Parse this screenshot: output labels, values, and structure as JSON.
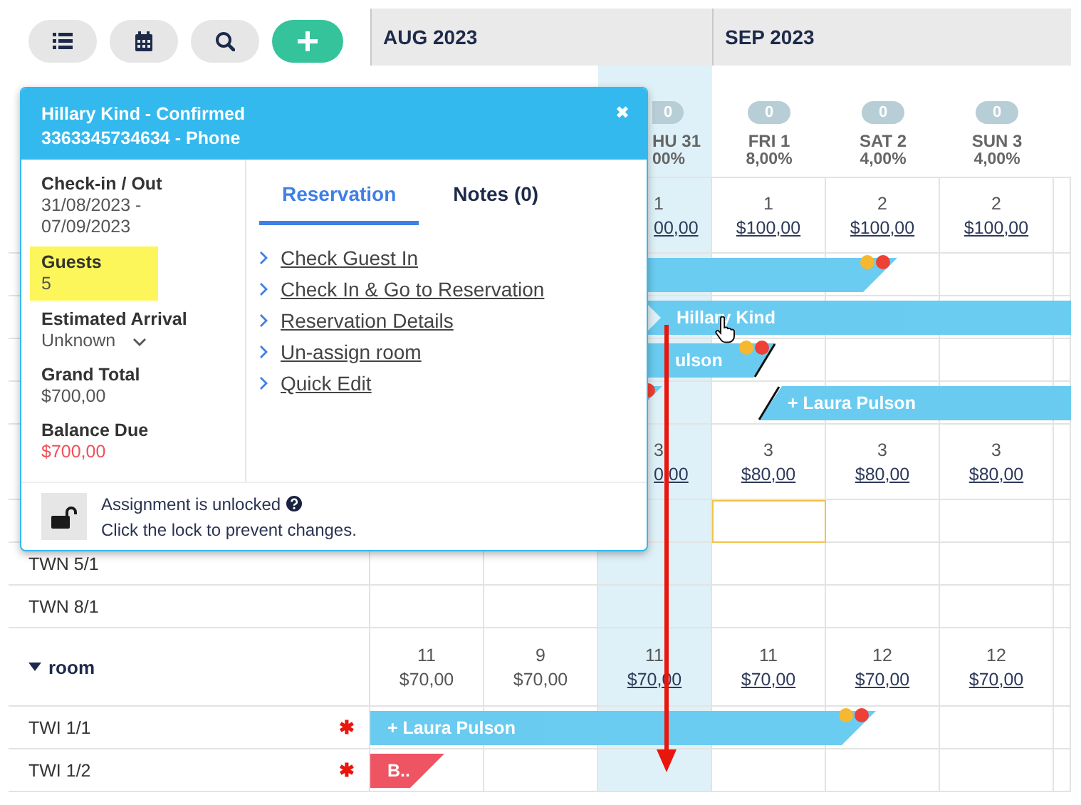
{
  "toolbar": [
    {
      "kind": "list"
    },
    {
      "kind": "calendar"
    },
    {
      "kind": "search"
    },
    {
      "kind": "add"
    }
  ],
  "months": [
    {
      "label": "AUG 2023"
    },
    {
      "label": "SEP 2023"
    }
  ],
  "days": [
    {
      "badge": "0",
      "name": "HU 31",
      "occupancy": "00%",
      "selected": true
    },
    {
      "badge": "0",
      "name": "FRI 1",
      "occupancy": "8,00%",
      "selected": false
    },
    {
      "badge": "0",
      "name": "SAT 2",
      "occupancy": "4,00%",
      "selected": false
    },
    {
      "badge": "0",
      "name": "SUN 3",
      "occupancy": "4,00%",
      "selected": false
    }
  ],
  "rows": [
    {
      "kind": "rates",
      "cells": [
        {
          "count": "1",
          "price": "00,00",
          "underlined": true
        },
        {
          "count": "1",
          "price": "$100,00",
          "underlined": true
        },
        {
          "count": "2",
          "price": "$100,00",
          "underlined": true
        },
        {
          "count": "2",
          "price": "$100,00",
          "underlined": true
        }
      ]
    },
    {
      "kind": "lane"
    },
    {
      "kind": "lane"
    },
    {
      "kind": "lane"
    },
    {
      "kind": "lane"
    },
    {
      "kind": "rates",
      "cells": [
        {
          "count": "3",
          "price": "0,00",
          "underlined": true
        },
        {
          "count": "3",
          "price": "$80,00",
          "underlined": true
        },
        {
          "count": "3",
          "price": "$80,00",
          "underlined": true
        },
        {
          "count": "3",
          "price": "$80,00",
          "underlined": true
        }
      ]
    },
    {
      "kind": "lane",
      "cells": [
        {
          "outlined": false
        },
        {
          "outlined": true
        },
        {
          "outlined": false
        },
        {
          "outlined": false
        }
      ]
    },
    {
      "kind": "unit",
      "label": "TWN 5/1"
    },
    {
      "kind": "unit",
      "label": "TWN 8/1"
    },
    {
      "kind": "group",
      "label": "room",
      "expanded": true,
      "cells": [
        {
          "count": "11",
          "price": "$70,00",
          "underlined": false
        },
        {
          "count": "9",
          "price": "$70,00",
          "underlined": false
        },
        {
          "count": "11",
          "price": "$70,00",
          "underlined": true
        },
        {
          "count": "11",
          "price": "$70,00",
          "underlined": true
        },
        {
          "count": "12",
          "price": "$70,00",
          "underlined": true
        },
        {
          "count": "12",
          "price": "$70,00",
          "underlined": true
        }
      ]
    },
    {
      "kind": "unit",
      "label": "TWI 1/1",
      "mark": "✱"
    },
    {
      "kind": "unit",
      "label": "TWI 1/2",
      "mark": "✱"
    }
  ],
  "bookings": [
    {
      "color": "#63c9f0",
      "flags": [
        {
          "color": "#f5b82e"
        },
        {
          "color": "#ef4035"
        }
      ]
    },
    {
      "label": "Hillary Kind",
      "color": "#63c9f0"
    },
    {
      "label": "ulson",
      "color": "#63c9f0",
      "flags": [
        {
          "color": "#f5b82e"
        },
        {
          "color": "#ef4035"
        }
      ]
    },
    {
      "color": "#63c9f0",
      "flags": [
        {
          "color": "#ef4035"
        }
      ]
    },
    {
      "label": "+ Laura Pulson",
      "color": "#63c9f0"
    },
    {
      "label": "+ Laura Pulson",
      "color": "#63c9f0",
      "flags": [
        {
          "color": "#f5b82e"
        },
        {
          "color": "#ef4035"
        }
      ]
    },
    {
      "label": "B..",
      "color": "#ef4b5a"
    }
  ],
  "popup": {
    "title": "Hillary Kind - Confirmed",
    "subtitle": "3363345734634 - Phone",
    "close": "✖",
    "fields": [
      {
        "label": "Check-in / Out",
        "value": "31/08/2023 - 07/09/2023",
        "kind": "text",
        "highlighted": false
      },
      {
        "label": "Guests",
        "value": "5",
        "kind": "text",
        "highlighted": true
      },
      {
        "label": "Estimated Arrival",
        "value": "Unknown",
        "kind": "select",
        "highlighted": false
      },
      {
        "label": "Grand Total",
        "value": "$700,00",
        "kind": "text",
        "highlighted": false
      },
      {
        "label": "Balance Due",
        "value": "$700,00",
        "kind": "due",
        "highlighted": false
      }
    ],
    "tabs": [
      {
        "label": "Reservation",
        "selected": true
      },
      {
        "label": "Notes (0)",
        "selected": false
      }
    ],
    "actions": [
      "Check Guest In",
      "Check In & Go to Reservation",
      "Reservation Details",
      "Un-assign room",
      "Quick Edit"
    ],
    "lock": {
      "locked": false,
      "status": "Assignment is unlocked",
      "hint": "Click the lock to prevent changes."
    }
  }
}
